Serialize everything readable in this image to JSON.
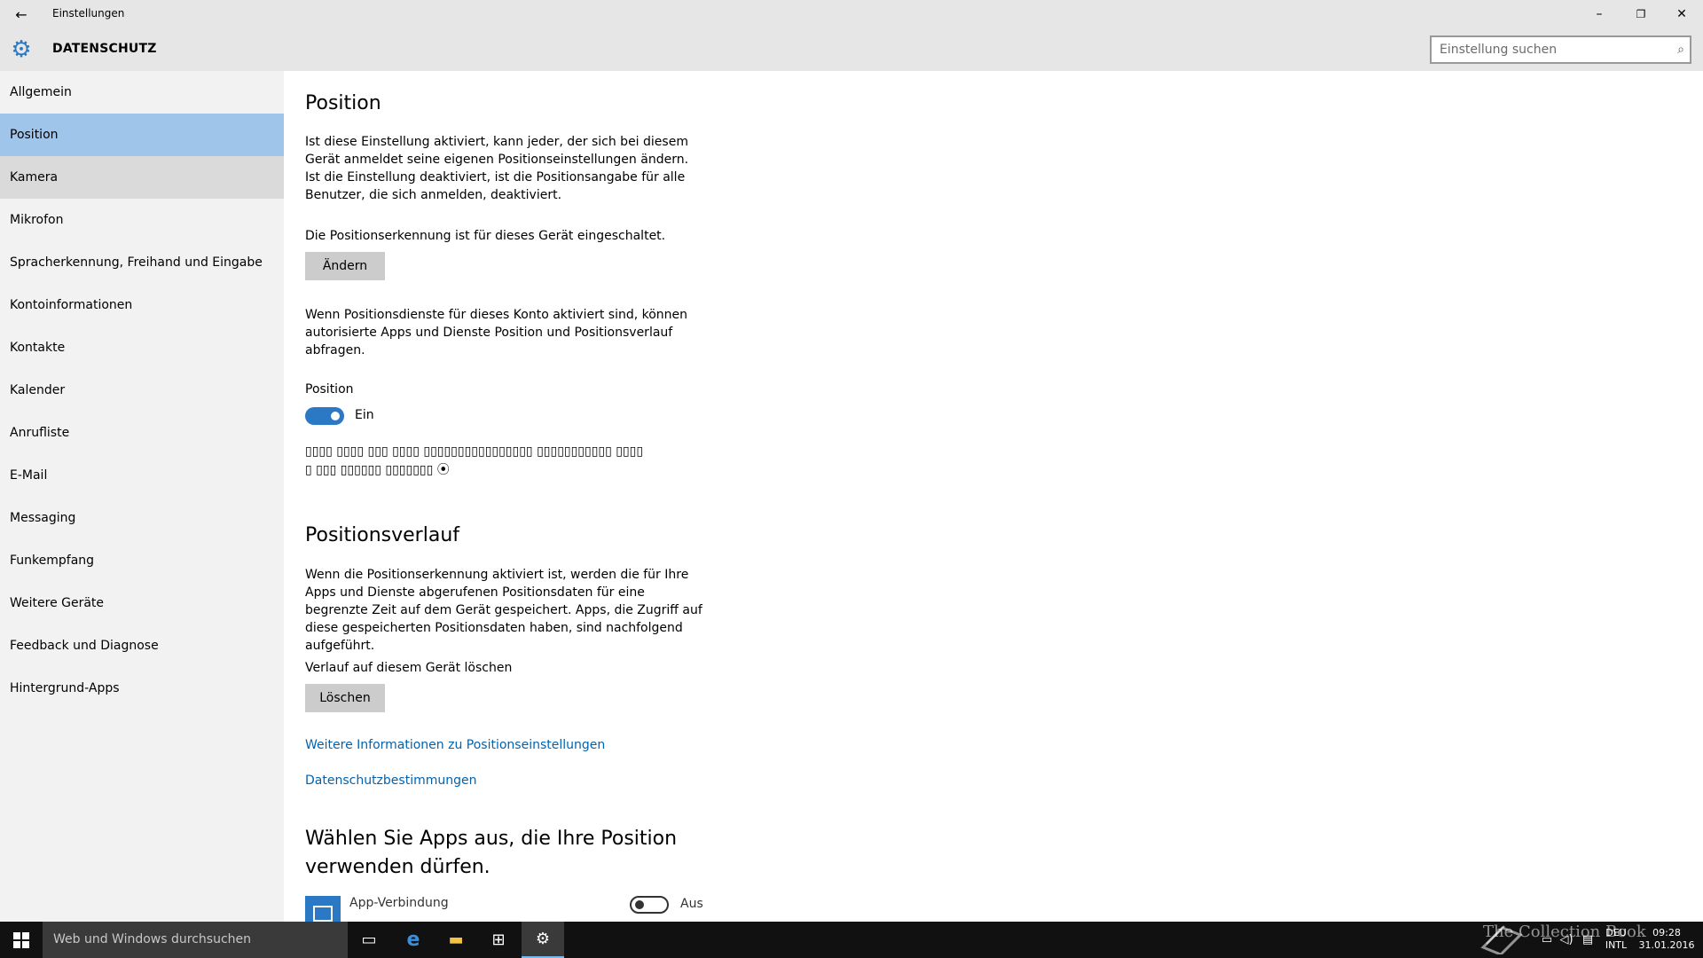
{
  "window": {
    "title": "Einstellungen",
    "back_icon": "←",
    "minimize_icon": "–",
    "maximize_icon": "❐",
    "close_icon": "✕"
  },
  "header": {
    "title": "DATENSCHUTZ",
    "gear_icon": "⚙",
    "search_placeholder": "Einstellung suchen",
    "search_value": "",
    "search_icon": "⌕"
  },
  "sidebar": {
    "items": [
      {
        "label": "Allgemein",
        "state": "normal"
      },
      {
        "label": "Position",
        "state": "selected"
      },
      {
        "label": "Kamera",
        "state": "hover"
      },
      {
        "label": "Mikrofon",
        "state": "normal"
      },
      {
        "label": "Spracherkennung, Freihand und Eingabe",
        "state": "normal"
      },
      {
        "label": "Kontoinformationen",
        "state": "normal"
      },
      {
        "label": "Kontakte",
        "state": "normal"
      },
      {
        "label": "Kalender",
        "state": "normal"
      },
      {
        "label": "Anrufliste",
        "state": "normal"
      },
      {
        "label": "E-Mail",
        "state": "normal"
      },
      {
        "label": "Messaging",
        "state": "normal"
      },
      {
        "label": "Funkempfang",
        "state": "normal"
      },
      {
        "label": "Weitere Geräte",
        "state": "normal"
      },
      {
        "label": "Feedback und Diagnose",
        "state": "normal"
      },
      {
        "label": "Hintergrund-Apps",
        "state": "normal"
      }
    ]
  },
  "content": {
    "position_heading": "Position",
    "position_desc": "Ist diese Einstellung aktiviert, kann jeder, der sich bei diesem Gerät anmeldet seine eigenen Positionseinstellungen ändern. Ist die Einstellung deaktiviert, ist die Positionsangabe für alle Benutzer, die sich anmelden, deaktiviert.",
    "device_status": "Die Positionserkennung ist für dieses Gerät eingeschaltet.",
    "change_button": "Ändern",
    "account_desc": "Wenn Positionsdienste für dieses Konto aktiviert sind, können autorisierte Apps und Dienste Position und Positionsverlauf abfragen.",
    "position_toggle_label": "Position",
    "position_toggle_state": "Ein",
    "position_toggle_on": true,
    "garbled_line1": "▯▯▯▯ ▯▯▯▯ ▯▯▯ ▯▯▯▯ ▯▯▯▯▯▯▯▯▯▯▯▯▯▯▯▯ ▯▯▯▯▯▯▯▯▯▯▯ ▯▯▯▯",
    "garbled_line2": "▯ ▯▯▯ ▯▯▯▯▯▯ ▯▯▯▯▯▯▯ ⦿",
    "history_heading": "Positionsverlauf",
    "history_desc": "Wenn die Positionserkennung aktiviert ist, werden die für Ihre Apps und Dienste abgerufenen Positionsdaten für eine begrenzte Zeit auf dem Gerät gespeichert. Apps, die Zugriff auf diese gespeicherten Positionsdaten haben, sind nachfolgend aufgeführt.",
    "clear_label": "Verlauf auf diesem Gerät löschen",
    "clear_button": "Löschen",
    "link_more_info": "Weitere Informationen zu Positionseinstellungen",
    "link_privacy": "Datenschutzbestimmungen",
    "apps_heading": "Wählen Sie Apps aus, die Ihre Position verwenden dürfen.",
    "apps": [
      {
        "name": "App-Verbindung",
        "toggle_state": "Aus",
        "on": false
      }
    ]
  },
  "taskbar": {
    "search_placeholder": "Web und Windows durchsuchen",
    "task_view_icon": "▭",
    "edge_icon": "e",
    "explorer_icon": "▬",
    "store_icon": "⊞",
    "settings_icon": "⚙",
    "tray_icons": [
      "network-icon",
      "volume-icon",
      "notification-icon"
    ],
    "lang_top": "DEU",
    "lang_bottom": "INTL",
    "time": "09:28",
    "date": "31.01.2016",
    "watermark": "The Collection Book"
  },
  "colors": {
    "accent": "#2b78c5",
    "selected": "#9fc5ea",
    "link": "#0063b1",
    "taskbar": "#111111"
  }
}
